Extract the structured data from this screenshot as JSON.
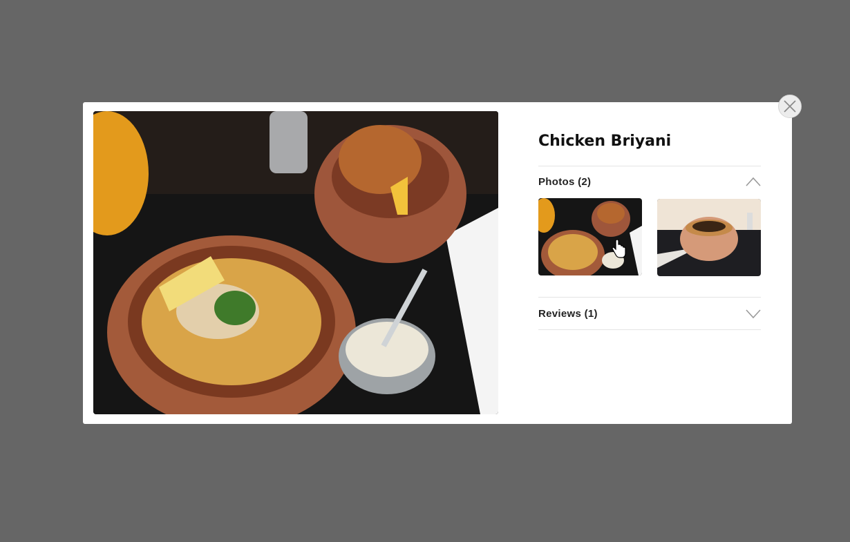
{
  "dish": {
    "title": "Chicken Briyani"
  },
  "photos_section": {
    "label": "Photos (2)",
    "expanded": true
  },
  "reviews_section": {
    "label": "Reviews (1)",
    "expanded": false
  },
  "thumbnails": [
    {
      "name": "briyani-pots-photo",
      "selected": true
    },
    {
      "name": "clay-pot-photo",
      "selected": false
    }
  ],
  "icons": {
    "close": "close-icon",
    "collapse": "chevron-up-icon",
    "expand": "chevron-down-icon"
  },
  "colors": {
    "overlay": "#666666",
    "modal": "#ffffff",
    "text": "#111111"
  }
}
